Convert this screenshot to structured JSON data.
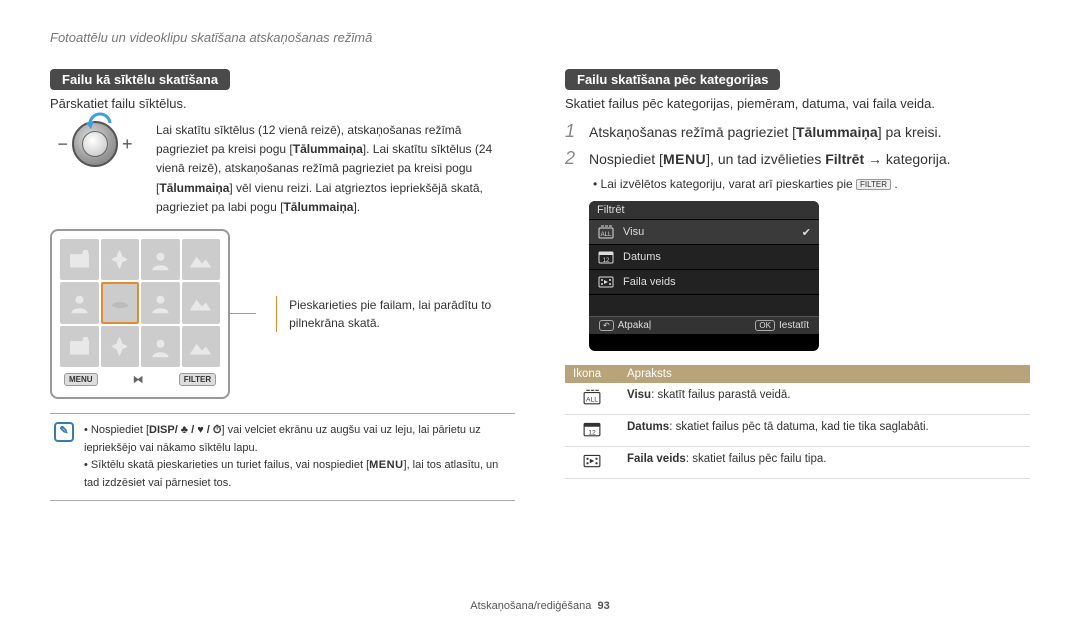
{
  "breadcrumb": "Fotoattēlu un videoklipu skatīšana atskaņošanas režīmā",
  "left": {
    "title": "Failu kā sīktēlu skatīšana",
    "intro": "Pārskatiet failu sīktēlus.",
    "dial_text": "Lai skatītu sīktēlus (12 vienā reizē), atskaņošanas režīmā pagrieziet pa kreisi pogu [Tālummaiņa]. Lai skatītu sīktēlus (24 vienā reizē), atskaņošanas režīmā pagrieziet pa kreisi pogu [Tālummaiņa] vēl vienu reizi. Lai atgrieztos iepriekšējā skatā, pagrieziet pa labi pogu [Tālummaiņa].",
    "screen_callout": "Pieskarieties pie failam, lai parādītu to pilnekrāna skatā.",
    "menu_btn": "MENU",
    "filter_btn": "FILTER",
    "note1_pre": "Nospiediet [",
    "note1_keys": "DISP/ ♣ / ♥ / ⏱",
    "note1_post": "] vai velciet ekrānu uz augšu vai uz leju, lai pārietu uz iepriekšējo vai nākamo sīktēlu lapu.",
    "note2_pre": "Sīktēlu skatā pieskarieties un turiet failus, vai nospiediet [",
    "note2_key": "MENU",
    "note2_post": "], lai tos atlasītu, un tad izdzēsiet vai pārnesiet tos."
  },
  "right": {
    "title": "Failu skatīšana pēc kategorijas",
    "intro": "Skatiet failus pēc kategorijas, piemēram, datuma, vai faila veida.",
    "step1_pre": "Atskaņošanas režīmā pagrieziet [",
    "step1_key": "Tālummaiņa",
    "step1_post": "] pa kreisi.",
    "step2_pre": "Nospiediet [",
    "step2_key": "MENU",
    "step2_mid": "], un tad izvēlieties ",
    "step2_filter": "Filtrēt",
    "step2_arrow": " → ",
    "step2_end": "kategorija.",
    "sub_bullet_pre": "Lai izvēlētos kategoriju, varat arī pieskarties pie ",
    "sub_bullet_key": "FILTER",
    "sub_bullet_post": " .",
    "filter_screen": {
      "header": "Filtrēt",
      "items": [
        "Visu",
        "Datums",
        "Faila veids"
      ],
      "footer_back": "Atpakaļ",
      "footer_set_key": "OK",
      "footer_set": "Iestatīt"
    },
    "table": {
      "h1": "Ikona",
      "h2": "Apraksts",
      "rows": [
        {
          "b": "Visu",
          "t": ": skatīt failus parastā veidā."
        },
        {
          "b": "Datums",
          "t": ": skatiet failus pēc tā datuma, kad tie tika saglabāti."
        },
        {
          "b": "Faila veids",
          "t": ": skatiet failus pēc failu tipa."
        }
      ]
    }
  },
  "footer": {
    "section": "Atskaņošana/rediģēšana",
    "page": "93"
  }
}
